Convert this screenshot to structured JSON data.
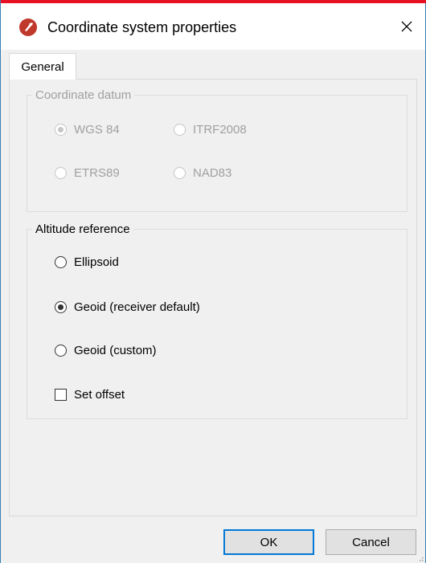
{
  "window": {
    "title": "Coordinate system properties",
    "close_label": "✕",
    "accent_color": "#e81123",
    "app_icon": "app-logo-icon"
  },
  "tabs": [
    {
      "label": "General",
      "selected": true
    }
  ],
  "coordinate_datum": {
    "legend": "Coordinate datum",
    "enabled": false,
    "options": [
      {
        "label": "WGS 84",
        "checked": true
      },
      {
        "label": "ITRF2008",
        "checked": false
      },
      {
        "label": "ETRS89",
        "checked": false
      },
      {
        "label": "NAD83",
        "checked": false
      }
    ]
  },
  "altitude_reference": {
    "legend": "Altitude reference",
    "options": [
      {
        "label": "Ellipsoid",
        "checked": false
      },
      {
        "label": "Geoid (receiver default)",
        "checked": true
      },
      {
        "label": "Geoid (custom)",
        "checked": false
      }
    ],
    "set_offset": {
      "label": "Set offset",
      "checked": false
    }
  },
  "buttons": {
    "ok_label": "OK",
    "cancel_label": "Cancel"
  }
}
